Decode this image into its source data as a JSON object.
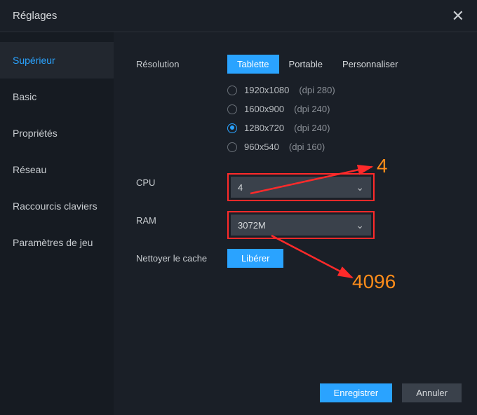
{
  "window": {
    "title": "Réglages"
  },
  "sidebar": {
    "items": [
      {
        "label": "Supérieur"
      },
      {
        "label": "Basic"
      },
      {
        "label": "Propriétés"
      },
      {
        "label": "Réseau"
      },
      {
        "label": "Raccourcis claviers"
      },
      {
        "label": "Paramètres de jeu"
      }
    ]
  },
  "resolution": {
    "label": "Résolution",
    "tabs": [
      {
        "label": "Tablette"
      },
      {
        "label": "Portable"
      },
      {
        "label": "Personnaliser"
      }
    ],
    "options": [
      {
        "size": "1920x1080",
        "dpi": "(dpi 280)"
      },
      {
        "size": "1600x900",
        "dpi": "(dpi 240)"
      },
      {
        "size": "1280x720",
        "dpi": "(dpi 240)"
      },
      {
        "size": "960x540",
        "dpi": "(dpi 160)"
      }
    ]
  },
  "cpu": {
    "label": "CPU",
    "value": "4"
  },
  "ram": {
    "label": "RAM",
    "value": "3072M"
  },
  "cache": {
    "label": "Nettoyer le cache",
    "button": "Libérer"
  },
  "footer": {
    "save": "Enregistrer",
    "cancel": "Annuler"
  },
  "annotations": {
    "cpu_target": "4",
    "ram_target": "4096"
  }
}
